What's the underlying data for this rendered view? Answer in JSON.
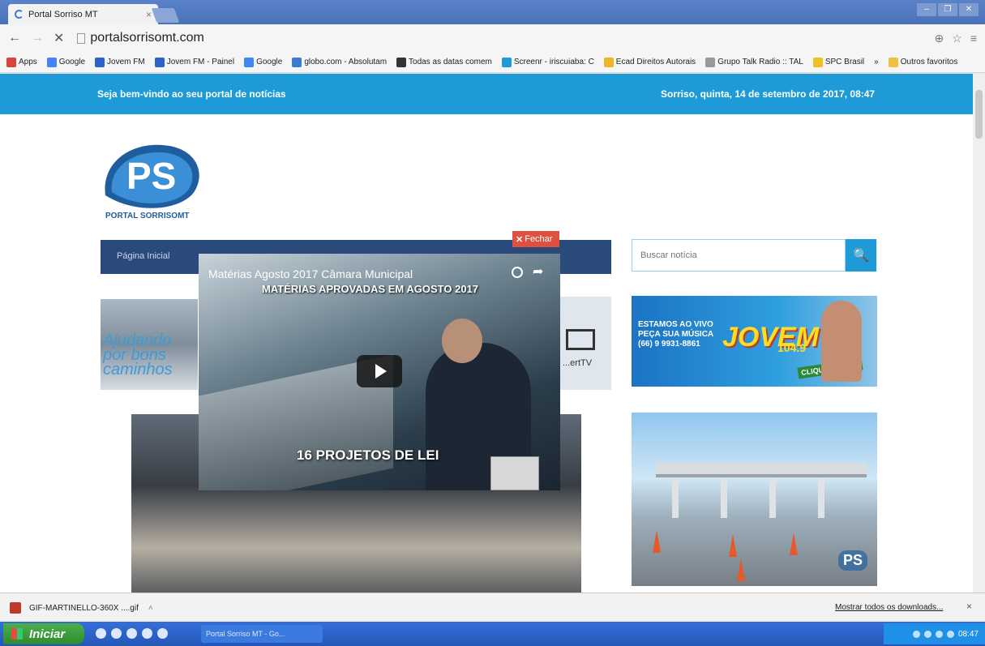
{
  "browser": {
    "tab_title": "Portal Sorriso MT",
    "tab_close": "×",
    "url": "portalsorrisomt.com",
    "nav_back": "←",
    "nav_forward": "→",
    "nav_stop": "✕",
    "window_controls": [
      "–",
      "❐",
      "✕"
    ],
    "bookmarks": [
      {
        "label": "Apps",
        "color": "#d9453a"
      },
      {
        "label": "Google",
        "color": "#4285f4"
      },
      {
        "label": "Jovem FM",
        "color": "#2b63c6"
      },
      {
        "label": "Jovem FM - Painel",
        "color": "#2b63c6"
      },
      {
        "label": "Google",
        "color": "#4285f4"
      },
      {
        "label": "globo.com - Absolutam",
        "color": "#3b7bd5"
      },
      {
        "label": "Todas as datas comem",
        "color": "#333333"
      },
      {
        "label": "Screenr - iriscuiaba: C",
        "color": "#1e9bd7"
      },
      {
        "label": "Ecad Direitos Autorais",
        "color": "#f0b429"
      },
      {
        "label": "Grupo Talk Radio :: TAL",
        "color": "#999999"
      },
      {
        "label": "SPC Brasil",
        "color": "#f0c020"
      }
    ],
    "bookmarks_overflow": "»",
    "other_bookmarks": "Outros favoritos"
  },
  "site": {
    "welcome": "Seja bem-vindo ao seu portal de notícias",
    "datetime": "Sorriso, quinta, 14 de setembro de 2017, 08:47",
    "logo_letters": "PS",
    "logo_text": "PORTAL SORRISOMT",
    "nav_item": "Página Inicial",
    "search_placeholder": "Buscar notícia",
    "slide_slogan": "Ajudando por bons caminhos",
    "slide_tv_label": "...ertTV"
  },
  "video": {
    "close_label": "Fechar",
    "title": "Matérias Agosto 2017 Câmara Municipal",
    "headline": "MATÉRIAS APROVADAS EM AGOSTO 2017",
    "caption": "16 PROJETOS DE LEI"
  },
  "ads": {
    "radio_live": "ESTAMOS AO VIVO",
    "radio_request": "PEÇA SUA MÚSICA",
    "radio_phone": "(66) 9 9931-8861",
    "radio_logo": "JOVEM",
    "radio_freq": "104.9",
    "radio_cta": "CLIQUE E OUÇA",
    "toll_badge": "PS"
  },
  "downloads": {
    "file_name": "GIF-MARTINELLO-360X ....gif",
    "show_all": "Mostrar todos os downloads...",
    "close": "×"
  },
  "taskbar": {
    "start_label": "Iniciar",
    "task_label": "Portal Sorriso MT - Go...",
    "clock": "08:47"
  }
}
